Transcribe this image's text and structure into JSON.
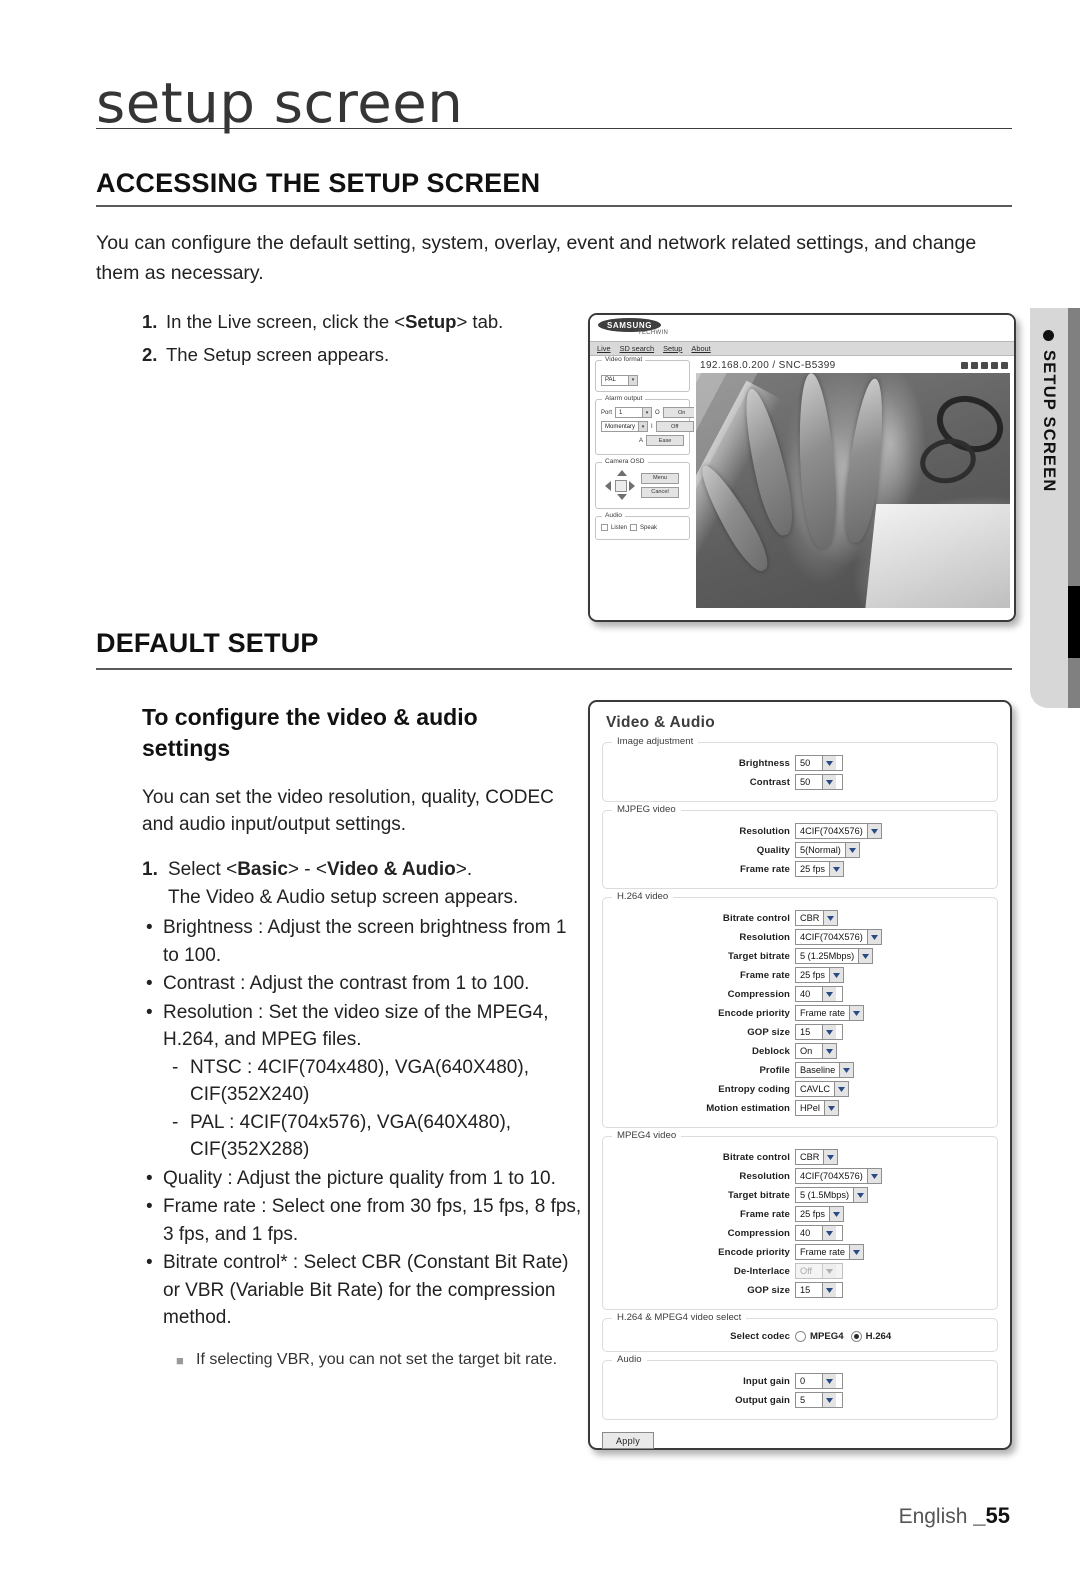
{
  "running_head": "setup screen",
  "sections": {
    "accessing": {
      "heading": "ACCESSING THE SETUP SCREEN",
      "intro": "You can configure the default setting, system, overlay, event and network related settings, and change them as necessary.",
      "steps": [
        {
          "num": "1.",
          "pre": "In the Live screen, click the <",
          "kw": "Setup",
          "post": "> tab."
        },
        {
          "num": "2.",
          "pre": "The Setup screen appears.",
          "kw": "",
          "post": ""
        }
      ]
    },
    "default_setup": {
      "heading": "DEFAULT SETUP",
      "sub_heading": "To configure the video & audio settings",
      "paragraph": "You can set the video resolution, quality, CODEC and audio input/output settings.",
      "step_num": "1.",
      "step_pre": "Select <",
      "step_kw1": "Basic",
      "step_mid": "> - <",
      "step_kw2": "Video & Audio",
      "step_post": ">.",
      "step_sub": "The Video & Audio setup screen appears.",
      "bullets": [
        "Brightness : Adjust the screen brightness from 1 to 100.",
        "Contrast : Adjust the contrast from 1 to 100.",
        "Resolution : Set the video size of the MPEG4, H.264, and MPEG files.",
        "Quality : Adjust the picture quality from 1 to 10.",
        "Frame rate : Select one from 30 fps, 15 fps, 8 fps, 3 fps, and 1 fps.",
        "Bitrate control* : Select CBR (Constant Bit Rate) or VBR (Variable Bit Rate) for the compression method."
      ],
      "dashes": [
        "NTSC : 4CIF(704x480), VGA(640X480), CIF(352X240)",
        "PAL : 4CIF(704x576), VGA(640X480), CIF(352X288)"
      ],
      "note": "If selecting VBR, you can not set the target bit rate."
    }
  },
  "side_tab": {
    "label": "SETUP SCREEN",
    "marker_icon": "bullet-dot-icon"
  },
  "footer": {
    "language": "English ",
    "page": "_55"
  },
  "live_screen": {
    "brand": "SAMSUNG",
    "brand_sub": "TECHWIN",
    "nav": [
      "Live",
      "SD search",
      "Setup",
      "About"
    ],
    "address": "192.168.0.200 / SNC-B5399",
    "toolbar_icons": [
      "print-icon",
      "capture-icon",
      "zoom-icon",
      "record-icon",
      "fullscreen-icon"
    ],
    "sidebar": {
      "video_format": {
        "legend": "Video format",
        "value": "PAL"
      },
      "alarm_output": {
        "legend": "Alarm output",
        "port_label": "Port",
        "port_value": "1",
        "mode_value": "Momentary",
        "o_label": "O",
        "i_label": "I",
        "a_label": "A",
        "buttons": [
          "On",
          "Off",
          "Ease"
        ]
      },
      "camera_osd": {
        "legend": "Camera OSD",
        "buttons": [
          "Menu",
          "Cancel"
        ]
      },
      "audio": {
        "legend": "Audio",
        "listen_label": "Listen",
        "speak_label": "Speak"
      }
    }
  },
  "setup_panel": {
    "title": "Video & Audio",
    "groups": [
      {
        "legend": "Image adjustment",
        "rows": [
          {
            "label": "Brightness",
            "value": "50",
            "type": "select"
          },
          {
            "label": "Contrast",
            "value": "50",
            "type": "select"
          }
        ]
      },
      {
        "legend": "MJPEG video",
        "rows": [
          {
            "label": "Resolution",
            "value": "4CIF(704X576)",
            "type": "select"
          },
          {
            "label": "Quality",
            "value": "5(Normal)",
            "type": "select"
          },
          {
            "label": "Frame rate",
            "value": "25 fps",
            "type": "select"
          }
        ]
      },
      {
        "legend": "H.264 video",
        "rows": [
          {
            "label": "Bitrate control",
            "value": "CBR",
            "type": "select"
          },
          {
            "label": "Resolution",
            "value": "4CIF(704X576)",
            "type": "select"
          },
          {
            "label": "Target bitrate",
            "value": "5 (1.25Mbps)",
            "type": "select"
          },
          {
            "label": "Frame rate",
            "value": "25 fps",
            "type": "select"
          },
          {
            "label": "Compression",
            "value": "40",
            "type": "select"
          },
          {
            "label": "Encode priority",
            "value": "Frame rate",
            "type": "select"
          },
          {
            "label": "GOP size",
            "value": "15",
            "type": "select"
          },
          {
            "label": "Deblock",
            "value": "On",
            "type": "select"
          },
          {
            "label": "Profile",
            "value": "Baseline",
            "type": "select"
          },
          {
            "label": "Entropy coding",
            "value": "CAVLC",
            "type": "select"
          },
          {
            "label": "Motion estimation",
            "value": "HPel",
            "type": "select"
          }
        ]
      },
      {
        "legend": "MPEG4 video",
        "rows": [
          {
            "label": "Bitrate control",
            "value": "CBR",
            "type": "select"
          },
          {
            "label": "Resolution",
            "value": "4CIF(704X576)",
            "type": "select"
          },
          {
            "label": "Target bitrate",
            "value": "5 (1.5Mbps)",
            "type": "select"
          },
          {
            "label": "Frame rate",
            "value": "25 fps",
            "type": "select"
          },
          {
            "label": "Compression",
            "value": "40",
            "type": "select"
          },
          {
            "label": "Encode priority",
            "value": "Frame rate",
            "type": "select"
          },
          {
            "label": "De-Interlace",
            "value": "Off",
            "type": "select-disabled"
          },
          {
            "label": "GOP size",
            "value": "15",
            "type": "select"
          }
        ]
      },
      {
        "legend": "H.264 & MPEG4 video select",
        "rows": [
          {
            "label": "Select codec",
            "type": "radio",
            "options": [
              "MPEG4",
              "H.264"
            ],
            "selected": "H.264"
          }
        ]
      },
      {
        "legend": "Audio",
        "rows": [
          {
            "label": "Input gain",
            "value": "0",
            "type": "select"
          },
          {
            "label": "Output gain",
            "value": "5",
            "type": "select"
          }
        ]
      }
    ],
    "apply_label": "Apply"
  }
}
